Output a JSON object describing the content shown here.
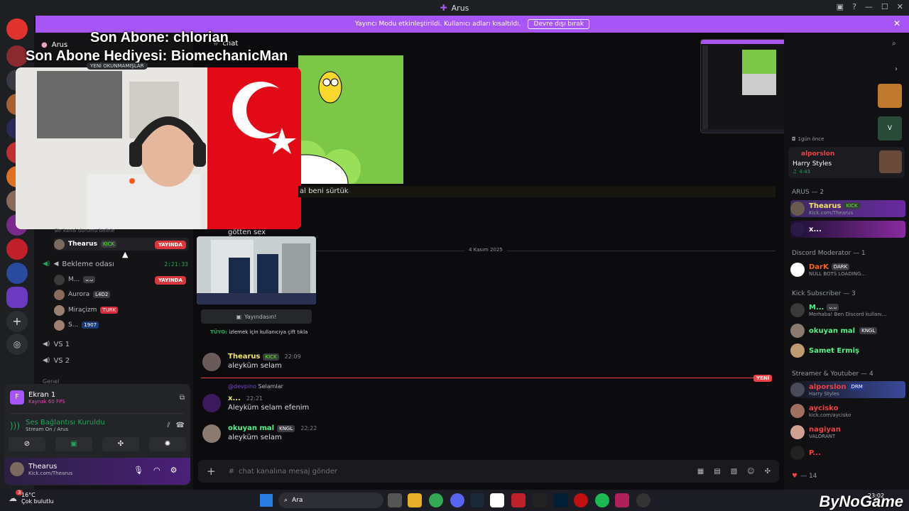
{
  "window": {
    "title": "Arus"
  },
  "notice": {
    "text": "Yayıncı Modu etkinleştirildi. Kullanıcı adları kısaltıldı.",
    "button": "Devre dışı bırak"
  },
  "overlay": {
    "line1": "Son Abone: chlorian",
    "line2": "Son Abone Hediyesi: BiomechanicMan"
  },
  "server": {
    "name": "Arus"
  },
  "unread_label": "YENİ OKUNMAMIŞLAR",
  "channel_header": {
    "name": "chat"
  },
  "voice": {
    "status_placeholder": "Bir kanal durumu belirle",
    "live_label": "YAYINDA",
    "main_user": {
      "name": "Thearus",
      "badge": "KICK"
    },
    "waiting_room": {
      "name": "Bekleme odası",
      "timer": "2:21:33"
    },
    "members": [
      {
        "name": "M...",
        "badge": "ᴗ.ᴗ",
        "live": true
      },
      {
        "name": "Aurora",
        "badge": "L4D2"
      },
      {
        "name": "Miraçizm",
        "badge": "TURK"
      },
      {
        "name": "S...",
        "badge": "1907"
      }
    ],
    "channels": [
      "VS 1",
      "VS 2"
    ],
    "category": "Genel"
  },
  "panel": {
    "screen_title": "Ekran 1",
    "screen_sub": "Kaynak 60 FPS",
    "voice_status": "Ses Bağlantısı Kuruldu",
    "voice_sub": "Stream On / Arus",
    "user_name": "Thearus",
    "user_sub": "Kick.com/Thearus"
  },
  "chat": {
    "caption1": "al beni sürtük",
    "caption2": "götten sex",
    "date_divider": "4 Kasım 2025",
    "watch_button": "Yayındasın!",
    "tip_label": "TÜYO:",
    "tip_text": "izlemek için kullanıcıya çift tıkla",
    "new_label": "YENİ",
    "messages": [
      {
        "author": "Thearus",
        "badge": "KICK",
        "time": "22:09",
        "text": "aleyküm selam",
        "color": "#f5e663"
      },
      {
        "reply_to": "@devpino",
        "reply_text": "Selamlar",
        "author": "x...",
        "time": "22:21",
        "text": "Aleyküm selam efenim",
        "color": "#f5e663"
      },
      {
        "author": "okuyan mal",
        "badge": "KNGL",
        "time": "22:22",
        "text": "aleyküm selam",
        "color": "#57f287"
      }
    ],
    "composer_placeholder": "chat kanalına mesaj gönder"
  },
  "members": {
    "activity_time": "1gün önce",
    "activity_user": {
      "name": "alporslon",
      "song": "Harry Styles",
      "duration": "4:43"
    },
    "groups": [
      {
        "title": "ARUS — 2",
        "items": [
          {
            "name": "Thearus",
            "badge": "KICK",
            "sub": "Kick.com/Thearus",
            "color": "#f5e663"
          },
          {
            "name": "x...",
            "sub": "",
            "color": "#ffffff"
          }
        ]
      },
      {
        "title": "Discord Moderator — 1",
        "items": [
          {
            "name": "DarK",
            "badge": "DARK",
            "sub": "NULL BOTS LOADING...",
            "color": "#f26522"
          }
        ]
      },
      {
        "title": "Kick Subscriber — 3",
        "items": [
          {
            "name": "M...",
            "badge": "ᴗ.ᴗ",
            "sub": "Merhaba! Ben Discord kullanı...",
            "color": "#57f287"
          },
          {
            "name": "okuyan mal",
            "badge": "KNGL",
            "sub": "",
            "color": "#57f287"
          },
          {
            "name": "Samet Ermiş",
            "sub": "",
            "color": "#57f287"
          }
        ]
      },
      {
        "title": "Streamer & Youtuber — 4",
        "items": [
          {
            "name": "alporslon",
            "badge": "DRM",
            "sub": "Harry Styles",
            "color": "#ed4245"
          },
          {
            "name": "aycisko",
            "sub": "kick.com/aycisko",
            "color": "#ed4245"
          },
          {
            "name": "nagiyan",
            "sub": "VALORANT",
            "color": "#ed4245"
          },
          {
            "name": "P...",
            "sub": "",
            "color": "#ed4245"
          }
        ]
      }
    ],
    "footer_count": "— 14"
  },
  "taskbar": {
    "weather_temp": "16°C",
    "weather_text": "Çok bulutlu",
    "search_placeholder": "Ara",
    "clock": "23:02",
    "notification_count": "3"
  },
  "watermark": "ByNoGame",
  "colors": {
    "accent": "#a855f7",
    "live": "#da373c",
    "kick": "#53fc18"
  }
}
